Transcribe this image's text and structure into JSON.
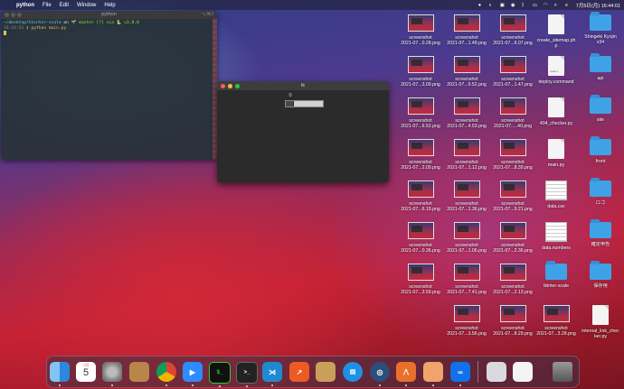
{
  "menubar": {
    "apple": "",
    "app": "python",
    "items": [
      "File",
      "Edit",
      "Window",
      "Help"
    ],
    "clock": "7月5日(月) 16:44:01"
  },
  "terminal": {
    "title": "python",
    "shortcut": "⌥⌘2",
    "lines": {
      "path": "~/desktop/tkinter-scale",
      "on": " on ",
      "branch": "🌱 master [?] via 🐍 v3.8.0",
      "time": "16:43:53",
      "prompt": " ❯ python main.py"
    }
  },
  "tk_window": {
    "title": "tk",
    "scale_value": "0"
  },
  "desktop_icons": {
    "col1": [
      "screenshot\n2021-07...0.28.png",
      "screenshot\n2021-07...3.09.png",
      "screenshot\n2021-07...6.52.png",
      "screenshot\n2021-07...2.09.png",
      "screenshot\n2021-07...6.19.png",
      "screenshot\n2021-07...0.36.png",
      "screenshot\n2021-07...3.59.png"
    ],
    "col2": [
      "screenshot\n2021-07...1.49.png",
      "screenshot\n2021-07...9.52.png",
      "screenshot\n2021-07...4.53.png",
      "screenshot\n2021-07...1.12.png",
      "screenshot\n2021-07...1.36.png",
      "screenshot\n2021-07...1.06.png",
      "screenshot\n2021-07...7.41.png",
      "screenshot\n2021-07...3.56.png"
    ],
    "col3": [
      "screenshot\n2021-07...6.07.png",
      "screenshot\n2021-07...1.47.png",
      "screenshot\n2021-07.....40.png",
      "screenshot\n2021-07...8.39.png",
      "screenshot\n2021-07...9.21.png",
      "screenshot\n2021-07...2.36.png",
      "screenshot\n2021-07...2.13.png",
      "screenshot\n2021-07...8.29.png"
    ],
    "col4": [
      {
        "label": "create_sitemap.ph\np",
        "kind": "doc",
        "tag": ""
      },
      {
        "label": "deploy.command",
        "kind": "doc",
        "tag": "SHELL"
      },
      {
        "label": "404_checker.py",
        "kind": "doc",
        "tag": ""
      },
      {
        "label": "main.py",
        "kind": "doc",
        "tag": ""
      },
      {
        "label": "data.csv",
        "kind": "sheet",
        "tag": ""
      },
      {
        "label": "data.numbers",
        "kind": "sheet",
        "tag": ""
      },
      {
        "label": "tkinter-scale",
        "kind": "folder",
        "tag": ""
      },
      {
        "label": "screenshot\n2021-07...3.28.png",
        "kind": "thumb",
        "tag": ""
      }
    ],
    "col5": [
      {
        "label": "Shingeki Kyojin\nv34",
        "kind": "folder"
      },
      {
        "label": "api",
        "kind": "folder"
      },
      {
        "label": "site",
        "kind": "folder"
      },
      {
        "label": "front",
        "kind": "folder"
      },
      {
        "label": "ロゴ",
        "kind": "folder"
      },
      {
        "label": "確定申告",
        "kind": "folder"
      },
      {
        "label": "保存用",
        "kind": "folder"
      },
      {
        "label": "internal_link_chec\nker.py",
        "kind": "doc"
      }
    ]
  },
  "dock": {
    "calendar_month": "7月",
    "calendar_day": "5",
    "apps": [
      "finder",
      "calendar",
      "system-preferences",
      "contacts",
      "chrome",
      "zoom",
      "iterm",
      "terminal",
      "vscode",
      "activity",
      "archive",
      "docker",
      "finder-search",
      "stack",
      "keynote",
      "infinity"
    ]
  }
}
